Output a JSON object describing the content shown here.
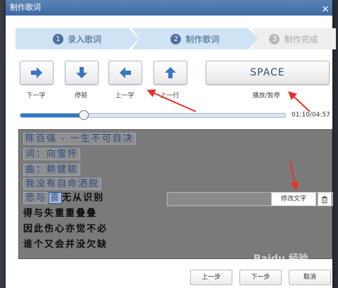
{
  "window": {
    "title": "制作歌词",
    "close": "×"
  },
  "steps": [
    {
      "num": "1",
      "label": "录入歌词"
    },
    {
      "num": "2",
      "label": "制作歌词"
    },
    {
      "num": "3",
      "label": "制作完成"
    }
  ],
  "controls": {
    "next_char": "下一字",
    "pause": "停顿",
    "prev_char": "上一字",
    "prev_line": "上一行",
    "space": "SPACE",
    "play_pause": "播放/暂停"
  },
  "progress": {
    "time": "01:10/04:57",
    "fraction": 0.236
  },
  "lyrics": {
    "done_lines": [
      "陈百强 - 一生不可自决",
      "词：向雪怀",
      "曲：赖健聪",
      "我没有自命洒脱"
    ],
    "current_line": {
      "done": "悲与",
      "current": "喜",
      "rest": "无从识别"
    },
    "todo_lines": [
      "得与失重重叠叠",
      "因此伤心亦觉不必",
      "谁个又会并没欠缺"
    ],
    "edit_label": "修改文字"
  },
  "footer": {
    "prev": "上一步",
    "next": "下一步",
    "cancel": "取消"
  },
  "watermark": "Baidu 经验",
  "colors": {
    "accent": "#2f78c8",
    "step_active": "#cfe3f5",
    "arrow": "#e8302a"
  }
}
